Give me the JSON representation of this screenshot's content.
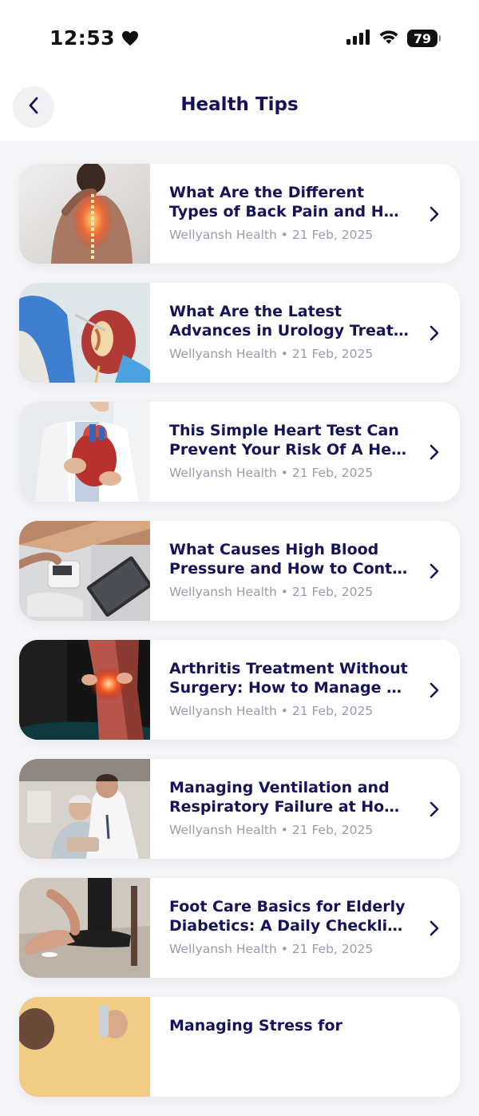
{
  "status_bar": {
    "time": "12:53",
    "battery": "79"
  },
  "header": {
    "title": "Health Tips"
  },
  "articles": [
    {
      "title_line1": "What Are the Different",
      "title_line2": "Types of Back Pain and Ho…",
      "author": "Wellyansh Health",
      "date": "21 Feb, 2025"
    },
    {
      "title_line1": "What Are the Latest",
      "title_line2": "Advances in Urology Treat…",
      "author": "Wellyansh Health",
      "date": "21 Feb, 2025"
    },
    {
      "title_line1": "This Simple Heart Test Can",
      "title_line2": "Prevent Your Risk Of A Hea…",
      "author": "Wellyansh Health",
      "date": "21 Feb, 2025"
    },
    {
      "title_line1": "What Causes High Blood",
      "title_line2": "Pressure and How to Contr…",
      "author": "Wellyansh Health",
      "date": "21 Feb, 2025"
    },
    {
      "title_line1": "Arthritis Treatment Without",
      "title_line2": "Surgery: How to Manage C…",
      "author": "Wellyansh Health",
      "date": "21 Feb, 2025"
    },
    {
      "title_line1": "Managing Ventilation and",
      "title_line2": "Respiratory Failure at Hom…",
      "author": "Wellyansh Health",
      "date": "21 Feb, 2025"
    },
    {
      "title_line1": "Foot Care Basics for Elderly",
      "title_line2": "Diabetics: A Daily Checklis…",
      "author": "Wellyansh Health",
      "date": "21 Feb, 2025"
    },
    {
      "title_line1": "Managing Stress for",
      "title_line2": "",
      "author": "",
      "date": ""
    }
  ],
  "meta_separator": "•",
  "colors": {
    "title": "#15145a",
    "meta": "#9a9cab",
    "background": "#f6f6f8"
  }
}
